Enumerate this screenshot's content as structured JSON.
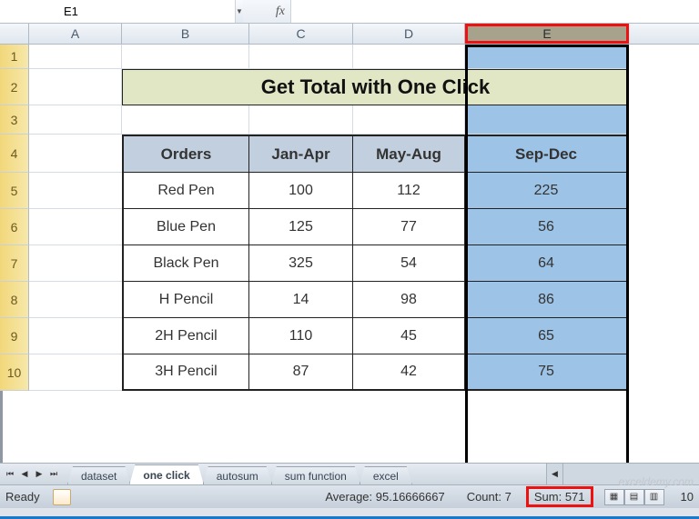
{
  "name_box": {
    "value": "E1"
  },
  "fx": {
    "label": "fx",
    "value": ""
  },
  "columns": [
    "A",
    "B",
    "C",
    "D",
    "E"
  ],
  "selected_column": "E",
  "row_numbers": [
    1,
    2,
    3,
    4,
    5,
    6,
    7,
    8,
    9,
    10
  ],
  "title": "Get Total with One Click",
  "table": {
    "headers": [
      "Orders",
      "Jan-Apr",
      "May-Aug",
      "Sep-Dec"
    ],
    "rows": [
      {
        "order": "Red Pen",
        "jan_apr": 100,
        "may_aug": 112,
        "sep_dec": 225
      },
      {
        "order": "Blue Pen",
        "jan_apr": 125,
        "may_aug": 77,
        "sep_dec": 56
      },
      {
        "order": "Black Pen",
        "jan_apr": 325,
        "may_aug": 54,
        "sep_dec": 64
      },
      {
        "order": "H Pencil",
        "jan_apr": 14,
        "may_aug": 98,
        "sep_dec": 86
      },
      {
        "order": "2H Pencil",
        "jan_apr": 110,
        "may_aug": 45,
        "sep_dec": 65
      },
      {
        "order": "3H Pencil",
        "jan_apr": 87,
        "may_aug": 42,
        "sep_dec": 75
      }
    ]
  },
  "sheet_tabs": {
    "items": [
      "dataset",
      "one click",
      "autosum",
      "sum function",
      "excel"
    ],
    "active": "one click"
  },
  "status": {
    "ready": "Ready",
    "average_label": "Average:",
    "average_value": "95.16666667",
    "count_label": "Count:",
    "count_value": "7",
    "sum_label": "Sum:",
    "sum_value": "571",
    "zoom": "10"
  },
  "watermark": "exceldemy.com"
}
